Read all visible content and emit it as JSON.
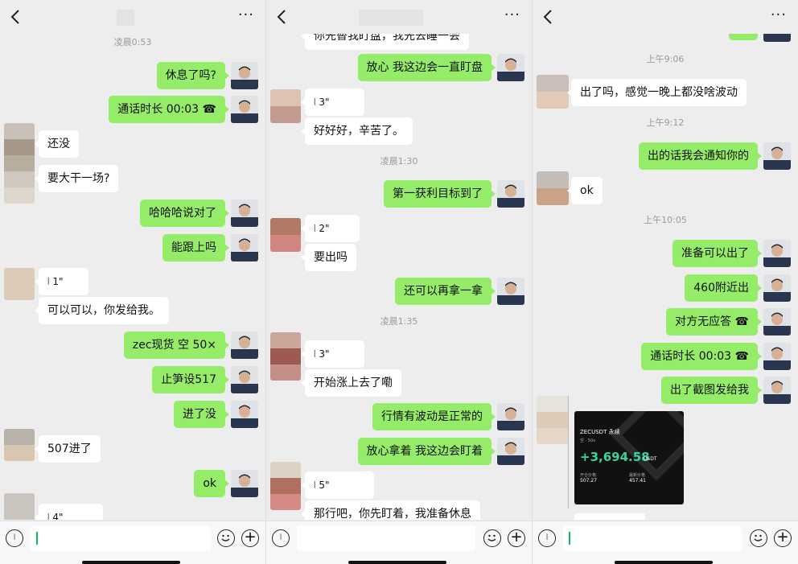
{
  "panels": [
    {
      "timestamps": [
        "凌晨0:53"
      ],
      "messages": {
        "m1": "休息了吗?",
        "m2": "通话时长 00:03",
        "m3": "还没",
        "m4": "要大干一场?",
        "m5": "哈哈哈说对了",
        "m6": "能跟上吗",
        "m7": "1\"",
        "m8": "可以可以，你发给我。",
        "m9": "zec现货 空 50×",
        "m10": "止笋设517",
        "m11": "进了没",
        "m12": "507进了",
        "m13": "ok",
        "m14": "4\""
      }
    },
    {
      "timestamps": [
        "凌晨1:30",
        "凌晨1:35"
      ],
      "messages": {
        "m1": "你先替我盯盘，我先去睡一会",
        "m2": "放心 我这边会一直盯盘",
        "m3": "3\"",
        "m4": "好好好，辛苦了。",
        "m5": "第一获利目标到了",
        "m6": "2\"",
        "m7": "要出吗",
        "m8": "还可以再拿一拿",
        "m9": "3\"",
        "m10": "开始涨上去了嘞",
        "m11": "行情有波动是正常的",
        "m12": "放心拿着 我这边会盯着",
        "m13": "5\"",
        "m14": "那行吧，你先盯着，我准备休息"
      }
    },
    {
      "timestamps": [
        "上午9:06",
        "上午9:12",
        "上午10:05"
      ],
      "messages": {
        "m1": "出了吗，感觉一晚上都没啥波动",
        "m2": "出的话我会通知你的",
        "m3": "ok",
        "m4": "准备可以出了",
        "m5": "460附近出",
        "m6": "对方无应答",
        "m7": "通话时长 00:03",
        "m8": "出了截图发给我"
      },
      "card": {
        "title": "ZECUSDT 永续",
        "sub": "空 · 50x",
        "pnl": "+3,694.58",
        "unit": "USDT",
        "open_label": "开仓价格",
        "open_value": "507.27",
        "close_label": "最新价格",
        "close_value": "457.41"
      }
    }
  ],
  "colors": {
    "sent_bubble": "#95ec69",
    "recv_bubble": "#ffffff",
    "background": "#ededed"
  },
  "icons": [
    "back-icon",
    "more-icon",
    "voice-input-icon",
    "emoji-icon",
    "plus-icon",
    "phone-icon",
    "voice-wave-icon"
  ]
}
